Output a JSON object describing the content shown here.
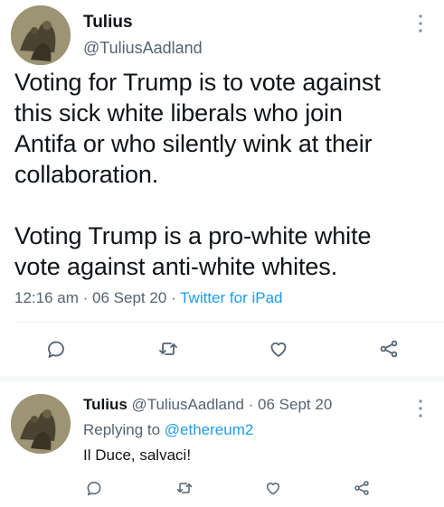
{
  "tweet": {
    "author_name": "Tulius",
    "author_handle": "@TuliusAadland",
    "text": "Voting for Trump is to vote against\nthis sick white liberals who join\nAntifa or who silently wink at their\ncollaboration.\n\nVoting Trump is a pro-white white\nvote against anti-white whites.",
    "time": "12:16 am",
    "date": "06 Sept 20",
    "separator": "·",
    "source": "Twitter for iPad",
    "actions": [
      "reply-icon",
      "retweet-icon",
      "like-icon",
      "share-icon"
    ]
  },
  "reply": {
    "author_name": "Tulius",
    "author_handle": "@TuliusAadland",
    "separator": "·",
    "date": "06 Sept 20",
    "replying_prefix": "Replying to",
    "replying_to": "@ethereum2",
    "text": "Il Duce, salvaci!",
    "actions": [
      "reply-icon",
      "retweet-icon",
      "like-icon",
      "share-icon"
    ]
  },
  "colors": {
    "accent": "#1d9bf0",
    "secondary_text": "#536471",
    "primary_text": "#0f1419",
    "divider": "#eff3f4"
  }
}
